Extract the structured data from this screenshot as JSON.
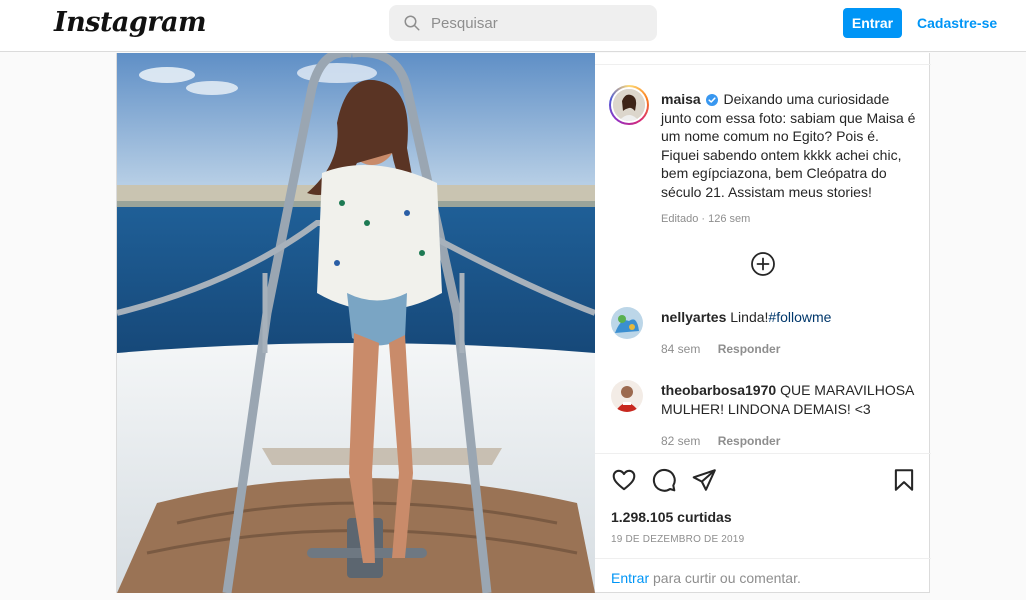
{
  "header": {
    "logo": "Instagram",
    "search_placeholder": "Pesquisar",
    "login_label": "Entrar",
    "signup_label": "Cadastre-se"
  },
  "post": {
    "author": "maisa",
    "caption": "Deixando uma curiosidade junto com essa foto: sabiam que Maisa é um nome comum no Egito? Pois é. Fiquei sabendo ontem kkkk achei chic, bem egípciazona, bem Cleópatra do século 21. Assistam meus stories!",
    "edited_label": "Editado",
    "separator": "·",
    "caption_time": "126 sem",
    "likes": "1.298.105 curtidas",
    "date": "19 DE DEZEMBRO DE 2019",
    "login_link": "Entrar",
    "login_cta": "para curtir ou comentar."
  },
  "comments": [
    {
      "user": "nellyartes",
      "text": "Linda!",
      "hashtag": "#followme",
      "time": "84 sem",
      "reply": "Responder"
    },
    {
      "user": "theobarbosa1970",
      "text": "QUE MARAVILHOSA MULHER! LINDONA DEMAIS! <3",
      "time": "82 sem",
      "reply": "Responder"
    }
  ],
  "icons": [
    "search-icon",
    "verified-icon",
    "load-more-icon",
    "heart-icon",
    "comment-icon",
    "share-icon",
    "save-icon"
  ],
  "colors": {
    "accent": "#0095f6",
    "verified": "#3897f0",
    "text": "#262626",
    "muted": "#8e8e8e",
    "hashtag": "#00376b"
  }
}
